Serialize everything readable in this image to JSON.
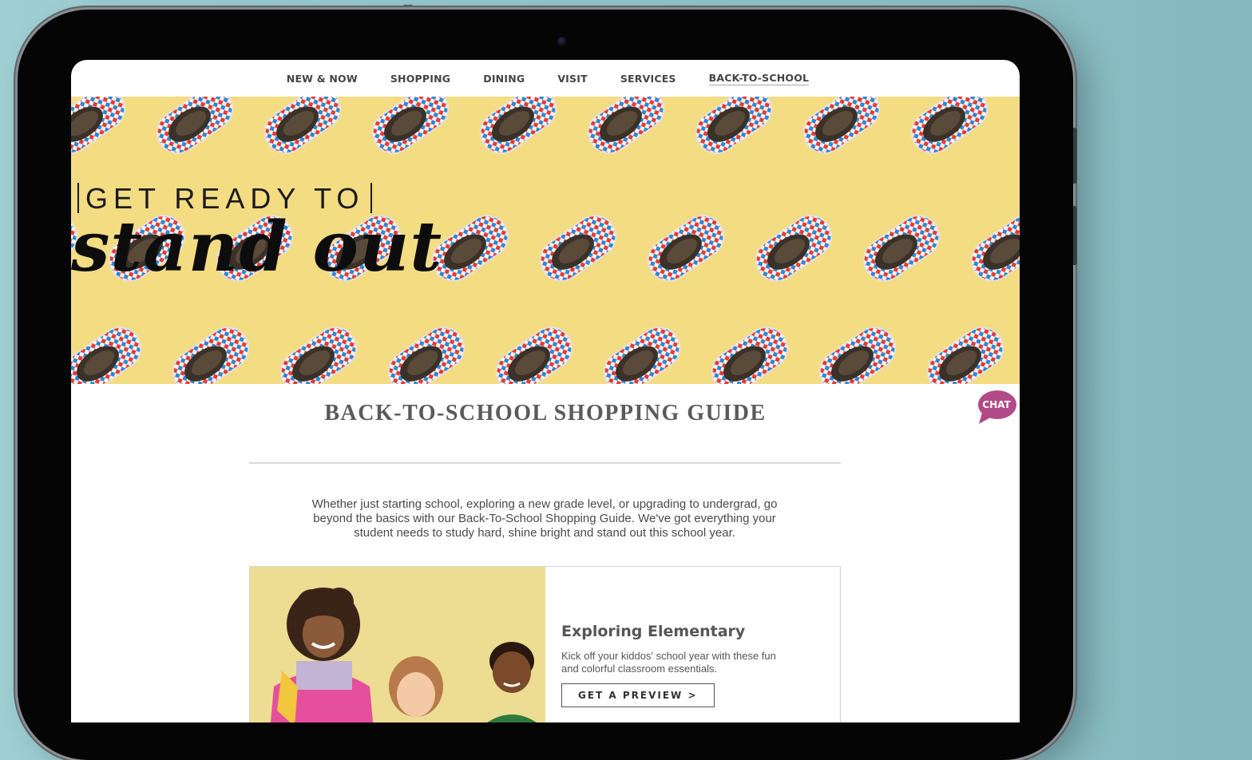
{
  "nav": {
    "items": [
      {
        "label": "NEW & NOW"
      },
      {
        "label": "SHOPPING"
      },
      {
        "label": "DINING"
      },
      {
        "label": "VISIT"
      },
      {
        "label": "SERVICES"
      },
      {
        "label": "BACK-TO-SCHOOL",
        "active": true
      }
    ]
  },
  "hero": {
    "line1": "GET READY TO",
    "line2": "stand out"
  },
  "chat": {
    "label": "CHAT"
  },
  "guide": {
    "title": "BACK-TO-SCHOOL SHOPPING GUIDE",
    "intro_lines": [
      "Whether just starting school, exploring a new grade level, or upgrading to undergrad, go",
      "beyond the basics with our Back-To-School Shopping Guide. We've got everything your",
      "student needs to study hard, shine bright and stand out this school year."
    ]
  },
  "card": {
    "title": "Exploring Elementary",
    "desc_lines": [
      "Kick off your kiddos' school year with these fun",
      "and colorful classroom essentials."
    ],
    "button": "GET A PREVIEW >"
  },
  "colors": {
    "background": "#8fc3c8",
    "hero_yellow": "#f3dc82",
    "chat_bubble": "#b24a87",
    "text_gray": "#5a5a5a"
  },
  "icons": {
    "chat": "chat-bubble-icon",
    "camera": "front-camera"
  }
}
